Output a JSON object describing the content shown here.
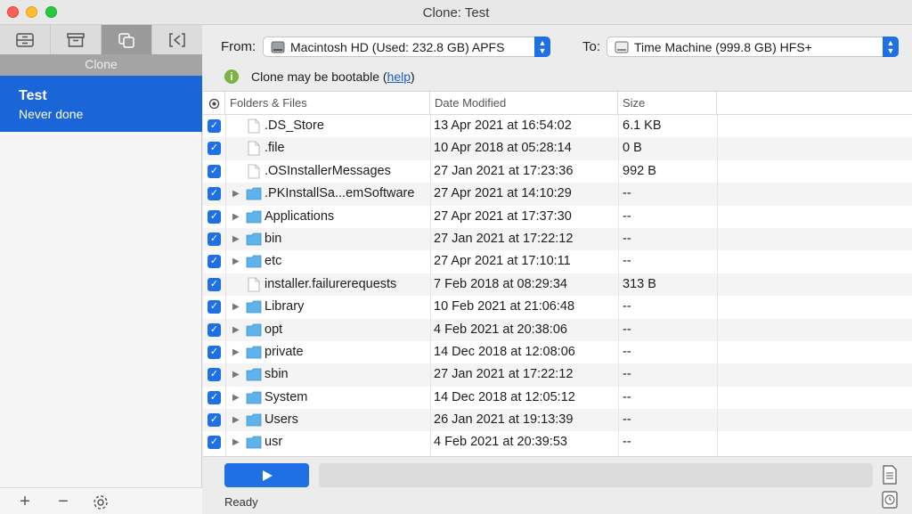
{
  "window": {
    "title": "Clone: Test"
  },
  "sidebar": {
    "tabs": [
      {
        "icon": "drive-icon"
      },
      {
        "icon": "archive-icon"
      },
      {
        "icon": "clone-icon",
        "active": true
      },
      {
        "icon": "sync-icon"
      }
    ],
    "active_tab_label": "Clone",
    "task": {
      "name": "Test",
      "status": "Never done"
    },
    "bottom": {
      "add": "+",
      "remove": "−"
    }
  },
  "source": {
    "label": "From:",
    "value": "Macintosh HD (Used: 232.8 GB)  APFS"
  },
  "destination": {
    "label": "To:",
    "value": "Time Machine (999.8 GB) HFS+"
  },
  "bootable": {
    "text": "Clone may be bootable (",
    "link": "help",
    "suffix": ")"
  },
  "table": {
    "columns": [
      "Folders & Files",
      "Date Modified",
      "Size"
    ],
    "rows": [
      {
        "name": ".DS_Store",
        "date": "13 Apr 2021 at 16:54:02",
        "size": "6.1 KB",
        "type": "file"
      },
      {
        "name": ".file",
        "date": "10 Apr 2018 at 05:28:14",
        "size": "0 B",
        "type": "file"
      },
      {
        "name": ".OSInstallerMessages",
        "date": "27 Jan 2021 at 17:23:36",
        "size": "992 B",
        "type": "file"
      },
      {
        "name": ".PKInstallSa...emSoftware",
        "date": "27 Apr 2021 at 14:10:29",
        "size": "--",
        "type": "folder"
      },
      {
        "name": "Applications",
        "date": "27 Apr 2021 at 17:37:30",
        "size": "--",
        "type": "folder"
      },
      {
        "name": "bin",
        "date": "27 Jan 2021 at 17:22:12",
        "size": "--",
        "type": "folder"
      },
      {
        "name": "etc",
        "date": "27 Apr 2021 at 17:10:11",
        "size": "--",
        "type": "folder"
      },
      {
        "name": "installer.failurerequests",
        "date": "7 Feb 2018 at 08:29:34",
        "size": "313 B",
        "type": "file"
      },
      {
        "name": "Library",
        "date": "10 Feb 2021 at 21:06:48",
        "size": "--",
        "type": "folder"
      },
      {
        "name": "opt",
        "date": "4 Feb 2021 at 20:38:06",
        "size": "--",
        "type": "folder"
      },
      {
        "name": "private",
        "date": "14 Dec 2018 at 12:08:06",
        "size": "--",
        "type": "folder"
      },
      {
        "name": "sbin",
        "date": "27 Jan 2021 at 17:22:12",
        "size": "--",
        "type": "folder"
      },
      {
        "name": "System",
        "date": "14 Dec 2018 at 12:05:12",
        "size": "--",
        "type": "folder"
      },
      {
        "name": "Users",
        "date": "26 Jan 2021 at 19:13:39",
        "size": "--",
        "type": "folder"
      },
      {
        "name": "usr",
        "date": "4 Feb 2021 at 20:39:53",
        "size": "--",
        "type": "folder"
      }
    ]
  },
  "status": {
    "text": "Ready"
  },
  "colors": {
    "accent": "#1f6fe5",
    "selection": "#1a65d8",
    "info": "#7cb342"
  }
}
